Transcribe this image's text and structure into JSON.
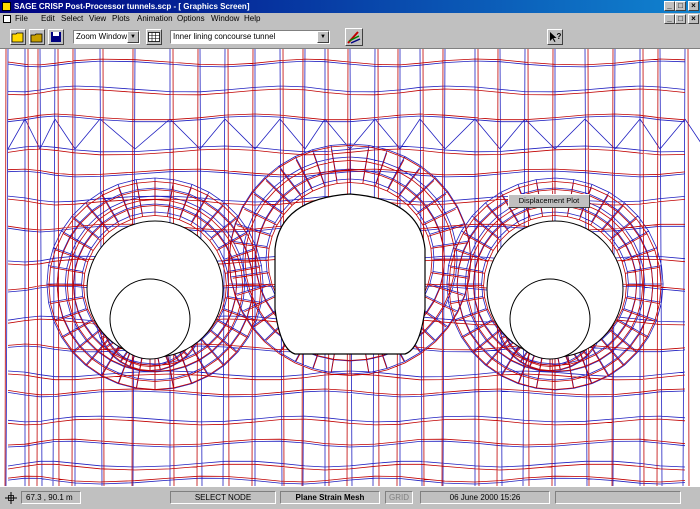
{
  "window": {
    "title": "SAGE CRISP Post-Processor tunnels.scp - [ Graphics Screen]"
  },
  "menu": {
    "items": [
      "File",
      "Edit",
      "Select",
      "View",
      "Plots",
      "Animation",
      "Options",
      "Window",
      "Help"
    ]
  },
  "toolbar": {
    "zoom_select": "Zoom Window",
    "lining_select": "Inner lining concourse tunnel"
  },
  "context_menu": {
    "item": "Displacement Plot"
  },
  "status": {
    "coords": "67.3 , 90.1 m",
    "mode": "SELECT NODE",
    "mesh_type": "Plane Strain Mesh",
    "grid": "GRID",
    "datetime": "06 June 2000 15:26"
  },
  "colors": {
    "undeformed_mesh": "#2020c0",
    "deformed_mesh": "#c00000",
    "title_bar": "#000080"
  }
}
